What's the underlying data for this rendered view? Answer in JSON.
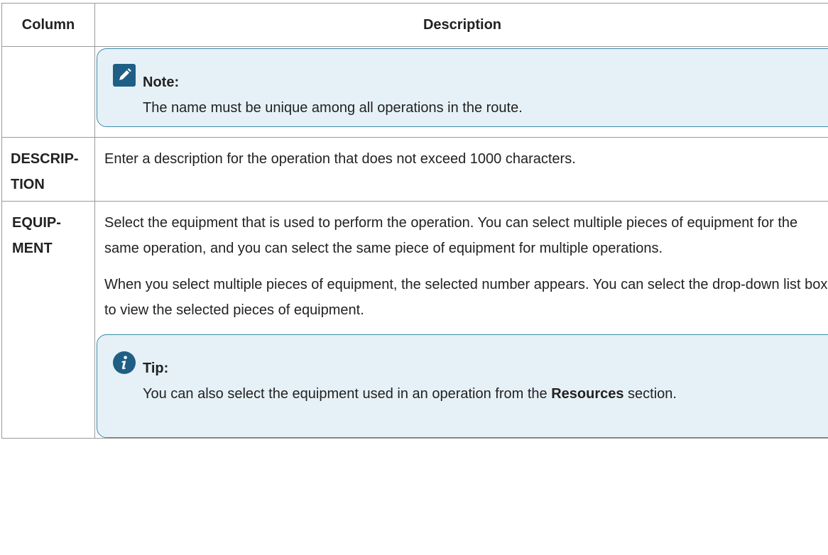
{
  "table": {
    "headers": {
      "column": "Column",
      "description": "Description"
    },
    "rows": [
      {
        "term": "",
        "note": {
          "icon": "pencil-icon",
          "title": "Note:",
          "text": "The name must be unique among all operations in the route."
        }
      },
      {
        "term": "DESCRIP-TION",
        "text": "Enter a description for the operation that does not exceed 1000 characters."
      },
      {
        "term": "EQUIP-MENT",
        "paragraphs": [
          "Select the equipment that is used to perform the operation. You can select multiple pieces of equipment for the same operation, and you can select the same piece of equipment for multiple operations.",
          "When you select multiple pieces of equipment, the selected number appears. You can select the drop-down list box to view the selected pieces of equipment."
        ],
        "tip": {
          "icon": "info-icon",
          "title": "Tip:",
          "text_before": "You can also select the equipment used in an operation from the ",
          "text_bold": "Resources",
          "text_after": " section."
        }
      }
    ]
  },
  "colors": {
    "callout_border": "#3c8aa8",
    "callout_background": "#e6f1f7",
    "icon_fill": "#1f5f86"
  }
}
